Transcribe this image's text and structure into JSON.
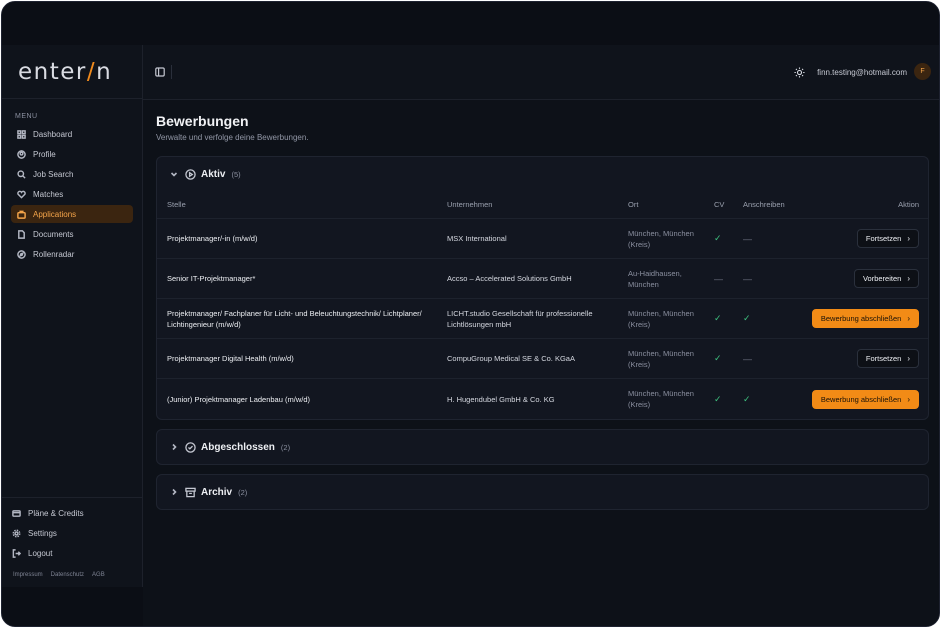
{
  "app": {
    "logo_main": "enter",
    "logo_slash": "/",
    "logo_end": "n"
  },
  "sidebar": {
    "menu_label": "MENU",
    "items": [
      {
        "label": "Dashboard",
        "icon": "dashboard-icon"
      },
      {
        "label": "Profile",
        "icon": "user-icon"
      },
      {
        "label": "Job Search",
        "icon": "search-icon"
      },
      {
        "label": "Matches",
        "icon": "heart-handshake-icon"
      },
      {
        "label": "Applications",
        "icon": "briefcase-icon",
        "active": true
      },
      {
        "label": "Documents",
        "icon": "document-icon"
      },
      {
        "label": "Rollenradar",
        "icon": "compass-icon"
      }
    ],
    "bottom_items": [
      {
        "label": "Pläne & Credits",
        "icon": "credit-card-icon"
      },
      {
        "label": "Settings",
        "icon": "gear-icon"
      },
      {
        "label": "Logout",
        "icon": "logout-icon"
      }
    ],
    "footer_links": [
      "Impressum",
      "Datenschutz",
      "AGB"
    ]
  },
  "header": {
    "email": "finn.testing@hotmail.com",
    "avatar_initial": "F"
  },
  "page": {
    "title": "Bewerbungen",
    "subtitle": "Verwalte und verfolge deine Bewerbungen."
  },
  "sections": {
    "active": {
      "title": "Aktiv",
      "count": "(5)"
    },
    "done": {
      "title": "Abgeschlossen",
      "count": "(2)"
    },
    "archive": {
      "title": "Archiv",
      "count": "(2)"
    }
  },
  "table": {
    "headers": {
      "stelle": "Stelle",
      "firma": "Unternehmen",
      "ort": "Ort",
      "cv": "CV",
      "ans": "Anschreiben",
      "aktion": "Aktion"
    },
    "rows": [
      {
        "stelle": "Projektmanager/-in (m/w/d)",
        "firma": "MSX International",
        "ort": "München, München (Kreis)",
        "cv": "✓",
        "ans": "—",
        "action": "Fortsetzen",
        "primary": false
      },
      {
        "stelle": "Senior IT-Projektmanager*",
        "firma": "Accso – Accelerated Solutions GmbH",
        "ort": "Au-Haidhausen, München",
        "cv": "—",
        "ans": "—",
        "action": "Vorbereiten",
        "primary": false
      },
      {
        "stelle": "Projektmanager/ Fachplaner für Licht- und Beleuchtungstechnik/ Lichtplaner/ Lichtingenieur (m/w/d)",
        "firma": "LICHT.studio Gesellschaft für professionelle Lichtlösungen mbH",
        "ort": "München, München (Kreis)",
        "cv": "✓",
        "ans": "✓",
        "action": "Bewerbung abschließen",
        "primary": true
      },
      {
        "stelle": "Projektmanager Digital Health (m/w/d)",
        "firma": "CompuGroup Medical SE & Co. KGaA",
        "ort": "München, München (Kreis)",
        "cv": "✓",
        "ans": "—",
        "action": "Fortsetzen",
        "primary": false
      },
      {
        "stelle": "(Junior) Projektmanager Ladenbau (m/w/d)",
        "firma": "H. Hugendubel GmbH & Co. KG",
        "ort": "München, München (Kreis)",
        "cv": "✓",
        "ans": "✓",
        "action": "Bewerbung abschließen",
        "primary": true
      }
    ]
  },
  "colors": {
    "accent": "#f28b16",
    "check": "#3fc27f",
    "background": "#0b0e15"
  }
}
